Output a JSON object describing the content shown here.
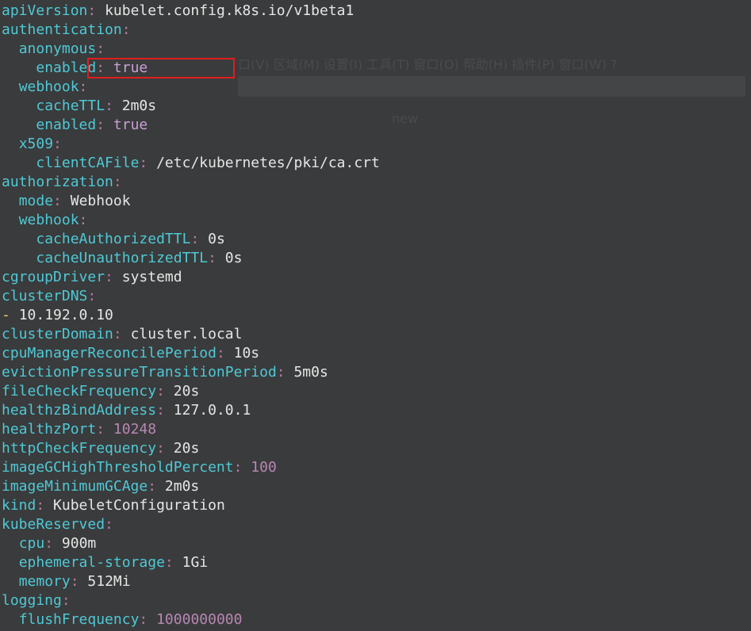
{
  "colors": {
    "background": "#3a3b3c",
    "key": "#4ec9d6",
    "punctuation": "#b87aa4",
    "value": "#e6e6e6",
    "number": "#b887b4",
    "boolean": "#c9a0d4",
    "list_dash": "#f0c674",
    "highlight_border": "#e11d1d"
  },
  "ghost": {
    "menu": "口(V)  区域(M)  设置(I)  工具(T)  窗口(O)  帮助(H)  插件(P)  窗口(W)  ?",
    "tab": "new"
  },
  "lines": [
    {
      "indent": "",
      "key": "apiVersion",
      "value": "kubelet.config.k8s.io/v1beta1",
      "kind": "val"
    },
    {
      "indent": "",
      "key": "authentication",
      "value": "",
      "kind": "val"
    },
    {
      "indent": "  ",
      "key": "anonymous",
      "value": "",
      "kind": "val"
    },
    {
      "indent": "    ",
      "key": "enabled",
      "value": "true",
      "kind": "bool",
      "highlight": true
    },
    {
      "indent": "  ",
      "key": "webhook",
      "value": "",
      "kind": "val"
    },
    {
      "indent": "    ",
      "key": "cacheTTL",
      "value": "2m0s",
      "kind": "val"
    },
    {
      "indent": "    ",
      "key": "enabled",
      "value": "true",
      "kind": "bool"
    },
    {
      "indent": "  ",
      "key": "x509",
      "value": "",
      "kind": "val"
    },
    {
      "indent": "    ",
      "key": "clientCAFile",
      "value": "/etc/kubernetes/pki/ca.crt",
      "kind": "val"
    },
    {
      "indent": "",
      "key": "authorization",
      "value": "",
      "kind": "val"
    },
    {
      "indent": "  ",
      "key": "mode",
      "value": "Webhook",
      "kind": "val"
    },
    {
      "indent": "  ",
      "key": "webhook",
      "value": "",
      "kind": "val"
    },
    {
      "indent": "    ",
      "key": "cacheAuthorizedTTL",
      "value": "0s",
      "kind": "val"
    },
    {
      "indent": "    ",
      "key": "cacheUnauthorizedTTL",
      "value": "0s",
      "kind": "val"
    },
    {
      "indent": "",
      "key": "cgroupDriver",
      "value": "systemd",
      "kind": "val"
    },
    {
      "indent": "",
      "key": "clusterDNS",
      "value": "",
      "kind": "val"
    },
    {
      "indent": "",
      "dash": "-",
      "value": "10.192.0.10",
      "kind": "val"
    },
    {
      "indent": "",
      "key": "clusterDomain",
      "value": "cluster.local",
      "kind": "val"
    },
    {
      "indent": "",
      "key": "cpuManagerReconcilePeriod",
      "value": "10s",
      "kind": "val"
    },
    {
      "indent": "",
      "key": "evictionPressureTransitionPeriod",
      "value": "5m0s",
      "kind": "val"
    },
    {
      "indent": "",
      "key": "fileCheckFrequency",
      "value": "20s",
      "kind": "val"
    },
    {
      "indent": "",
      "key": "healthzBindAddress",
      "value": "127.0.0.1",
      "kind": "val"
    },
    {
      "indent": "",
      "key": "healthzPort",
      "value": "10248",
      "kind": "num"
    },
    {
      "indent": "",
      "key": "httpCheckFrequency",
      "value": "20s",
      "kind": "val"
    },
    {
      "indent": "",
      "key": "imageGCHighThresholdPercent",
      "value": "100",
      "kind": "num"
    },
    {
      "indent": "",
      "key": "imageMinimumGCAge",
      "value": "2m0s",
      "kind": "val"
    },
    {
      "indent": "",
      "key": "kind",
      "value": "KubeletConfiguration",
      "kind": "val"
    },
    {
      "indent": "",
      "key": "kubeReserved",
      "value": "",
      "kind": "val"
    },
    {
      "indent": "  ",
      "key": "cpu",
      "value": "900m",
      "kind": "val"
    },
    {
      "indent": "  ",
      "key": "ephemeral-storage",
      "value": "1Gi",
      "kind": "val"
    },
    {
      "indent": "  ",
      "key": "memory",
      "value": "512Mi",
      "kind": "val"
    },
    {
      "indent": "",
      "key": "logging",
      "value": "",
      "kind": "val"
    },
    {
      "indent": "  ",
      "key": "flushFrequency",
      "value": "1000000000",
      "kind": "num"
    }
  ]
}
